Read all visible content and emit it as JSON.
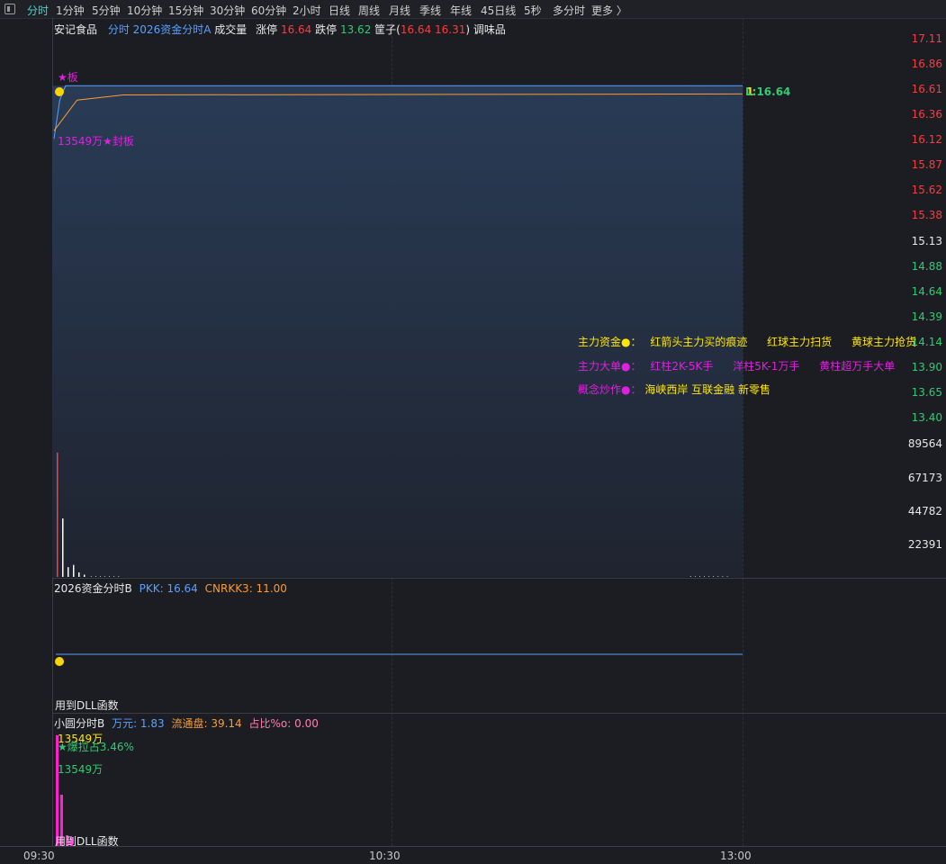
{
  "toolbar": {
    "items": [
      "分时",
      "1分钟",
      "5分钟",
      "10分钟",
      "15分钟",
      "30分钟",
      "60分钟",
      "2小时",
      "日线",
      "周线",
      "月线",
      "季线",
      "年线",
      "45日线",
      "5秒",
      "多分时",
      "更多 〉"
    ]
  },
  "main_header": {
    "stock_name": "安记食品",
    "indicator": "分时 2026资金分时A",
    "volume_label": "成交量",
    "limit_up_label": "涨停",
    "limit_up_value": "16.64",
    "limit_down_label": "跌停",
    "limit_down_value": "13.62",
    "basket_label": "筐子(",
    "basket_values": "16.64 16.31",
    "basket_close": ")",
    "flavor_label": "调味品"
  },
  "price_axis": {
    "upper": [
      "17.11",
      "16.86",
      "16.61",
      "16.36",
      "16.12",
      "15.87",
      "15.62",
      "15.38"
    ],
    "mid": "15.13",
    "lower": [
      "14.88",
      "14.64",
      "14.39",
      "14.14",
      "13.90",
      "13.65",
      "13.40"
    ]
  },
  "volume_axis": [
    "89564",
    "67173",
    "44782",
    "22391"
  ],
  "main_chart": {
    "tag_board": "★板",
    "tag_seal": "13549万★封板",
    "price_label": "L:16.64",
    "price_label_shadow": "1",
    "line_color": "#5aa0ff",
    "avg_color": "#ff9a2e",
    "close_price": 16.64
  },
  "notes": {
    "row1": {
      "title": "主力资金●：",
      "a": "红箭头主力买的痕迹",
      "b": "红球主力扫货",
      "c": "黄球主力抢货"
    },
    "row2": {
      "title": "主力大单●：",
      "a": "红柱2K-5K手",
      "b": "洋柱5K-1万手",
      "c": "黄柱超万手大单"
    },
    "row3": {
      "title": "概念炒作●：",
      "a": "海峡西岸 互联金融 新零售"
    }
  },
  "panel_b": {
    "title": "2026资金分时B",
    "pkk_label": "PKK: 16.64",
    "cnrkk_label": "CNRKK3: 11.00",
    "footer": "用到DLL函数"
  },
  "panel_c": {
    "title": "小圆分时B",
    "wanyuan": "万元: 1.83",
    "float_cap": "流通盘: 39.14",
    "ratio": "占比%o: 0.00",
    "label1": "13549万",
    "label2": "★爆拉占3.46%",
    "label3": "13549万",
    "footer": "用到DLL函数"
  },
  "time_axis": [
    "09:30",
    "10:30",
    "13:00"
  ],
  "chart_data": {
    "type": "line",
    "title": "",
    "xlabel": "",
    "ylabel": "",
    "price_ylim": [
      13.4,
      17.11
    ],
    "prev_close": 15.13,
    "price_series": [
      {
        "time": "09:30",
        "price": 16.12
      },
      {
        "time": "09:31",
        "price": 16.5
      },
      {
        "time": "09:32",
        "price": 16.64
      },
      {
        "time": "13:00",
        "price": 16.64
      }
    ],
    "avg_series": [
      {
        "time": "09:30",
        "avg": 16.2
      },
      {
        "time": "09:34",
        "avg": 16.5
      },
      {
        "time": "09:42",
        "avg": 16.55
      },
      {
        "time": "13:00",
        "avg": 16.56
      }
    ],
    "volume_ylim": [
      0,
      89564
    ],
    "volume_bars": [
      {
        "color": "#ff3b3b",
        "value": 83000
      },
      {
        "color": "#ffffff",
        "value": 39000
      },
      {
        "color": "#ffffff",
        "value": 6500
      },
      {
        "color": "#ffffff",
        "value": 8000
      },
      {
        "color": "#ffffff",
        "value": 3000
      },
      {
        "color": "#ffffff",
        "value": 1500
      }
    ]
  }
}
